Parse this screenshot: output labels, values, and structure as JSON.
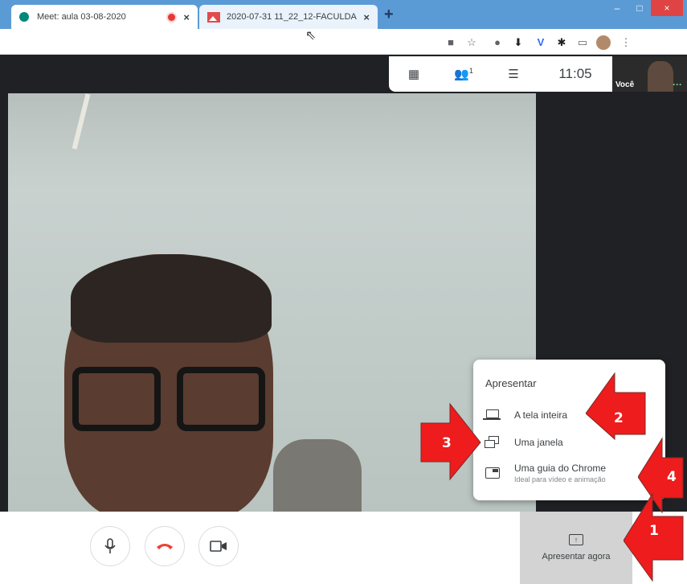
{
  "browser": {
    "tabs": [
      {
        "title": "Meet: aula 03-08-2020",
        "active": true
      },
      {
        "title": "2020-07-31 11_22_12-FACULDA",
        "active": false
      }
    ],
    "new_tab_label": "+",
    "tab_close_label": "×",
    "window": {
      "minimize": "–",
      "maximize": "□",
      "close": "×"
    },
    "toolbar_icons": [
      "camera-icon",
      "star-icon",
      "extension-icon",
      "download-icon",
      "v-extension-icon",
      "puzzle-icon",
      "cast-icon",
      "profile-avatar",
      "menu-icon"
    ],
    "menu_glyph": "⋮"
  },
  "meet": {
    "time": "11:05",
    "participants_count": "1",
    "self_label": "Você",
    "self_more": "···"
  },
  "bottom_bar": {
    "present_now_label": "Apresentar agora"
  },
  "present_menu": {
    "title": "Apresentar",
    "items": [
      {
        "label": "A tela inteira",
        "icon": "laptop-icon"
      },
      {
        "label": "Uma janela",
        "icon": "window-icon"
      },
      {
        "label": "Uma guia do Chrome",
        "sublabel": "Ideal para vídeo e animação",
        "icon": "chrome-tab-icon"
      }
    ]
  },
  "annotations": {
    "arrow_1": "1",
    "arrow_2": "2",
    "arrow_3": "3",
    "arrow_4": "4",
    "color": "#ee1c1c"
  },
  "colors": {
    "tabstrip": "#5b9bd5",
    "meet_bg": "#202124",
    "hangup_red": "#ea4335",
    "close_red": "#e04343"
  }
}
